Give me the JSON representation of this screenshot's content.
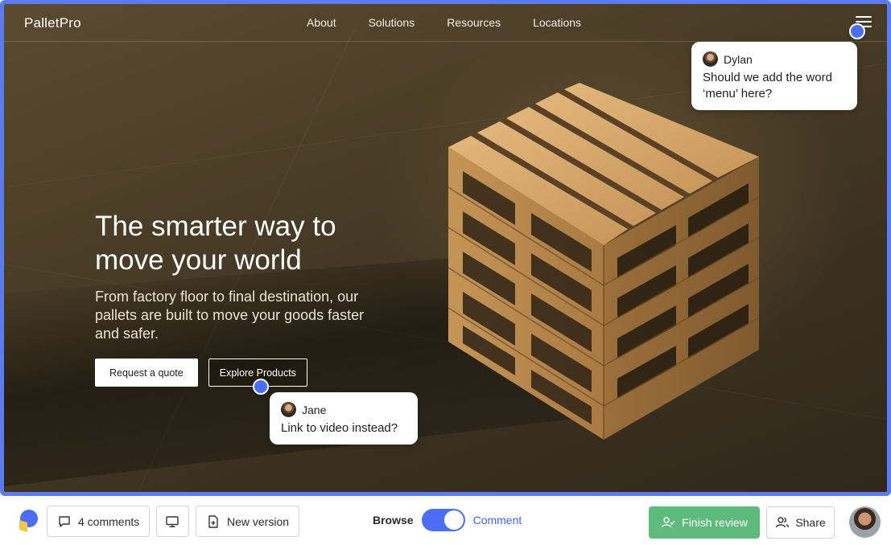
{
  "site": {
    "brand": "PalletPro",
    "nav": [
      "About",
      "Solutions",
      "Resources",
      "Locations"
    ],
    "headline": "The smarter way to move your world",
    "subhead": "From factory floor to final destination, our pallets are built to move your goods faster and safer.",
    "cta_primary": "Request a quote",
    "cta_secondary": "Explore Products"
  },
  "comments": [
    {
      "author": "Dylan",
      "text": "Should we add the word ‘menu’ here?"
    },
    {
      "author": "Jane",
      "text": "Link to video instead?"
    }
  ],
  "toolbar": {
    "comments_label": "4 comments",
    "new_version_label": "New version",
    "browse_label": "Browse",
    "comment_label": "Comment",
    "mode": "comment",
    "finish_label": "Finish review",
    "share_label": "Share"
  },
  "colors": {
    "accent": "#4b6ef5",
    "frame": "#5a7cf0",
    "finish": "#5fba7d"
  }
}
